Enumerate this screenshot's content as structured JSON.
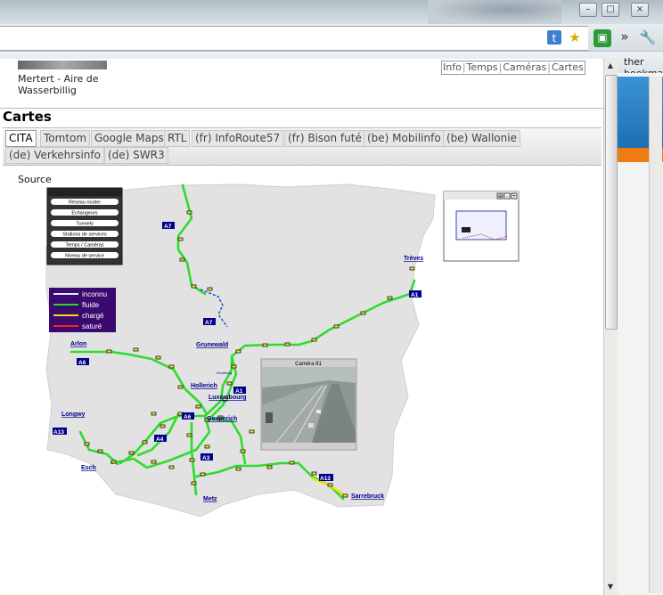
{
  "browser": {
    "minimize": "–",
    "maximize": "□",
    "close": "×",
    "bookmarks_text": "ther bookmarks",
    "chevron": "»",
    "wrench_icon": "wrench-icon",
    "star_icon": "star-icon"
  },
  "popup": {
    "place_line1": "Mertert - Aire de",
    "place_line2": "Wasserbillig",
    "top_links": [
      "Info",
      "Temps",
      "Caméras",
      "Cartes"
    ],
    "section_title": "Cartes",
    "tabs_row1": [
      "CITA",
      "Tomtom",
      "Google Maps",
      "RTL",
      "(fr) InfoRoute57",
      "(fr) Bison futé",
      "(be) Mobilinfo",
      "(be) Wallonie"
    ],
    "tabs_row2": [
      "(de) Verkehrsinfo",
      "(de) SWR3"
    ],
    "active_tab": "CITA",
    "source_label": "Source"
  },
  "map": {
    "menu_buttons": [
      "Réseau routier",
      "Echangeurs",
      "Tunnels",
      "Stations de services",
      "Temps / Caméras",
      "Niveau de service"
    ],
    "legend": [
      {
        "label": "inconnu",
        "color": "#e6e6ff"
      },
      {
        "label": "fluide",
        "color": "#22dd22"
      },
      {
        "label": "chargé",
        "color": "#f0e000"
      },
      {
        "label": "saturé",
        "color": "#ff2020"
      }
    ],
    "cities": [
      "Trèves",
      "Grunewald",
      "Arlon",
      "Hollerich",
      "Luxembourg",
      "Gasperich",
      "Longwy",
      "Esch",
      "Metz",
      "Sarrebruck",
      "Kirchberg"
    ],
    "roads": [
      "A7",
      "A7",
      "A1",
      "A6",
      "A1",
      "A6",
      "A4",
      "A13",
      "A3",
      "A13"
    ],
    "camera_title": "Caméra 81",
    "overview_controls": [
      "⊕",
      "–",
      "+"
    ]
  }
}
